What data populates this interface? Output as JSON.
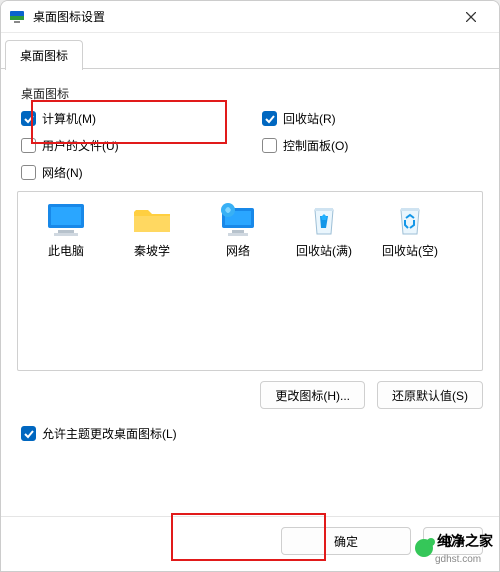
{
  "window": {
    "title": "桌面图标设置"
  },
  "tab": {
    "label": "桌面图标"
  },
  "group_label": "桌面图标",
  "checks": {
    "computer": {
      "label": "计算机(M)",
      "checked": true
    },
    "recycle": {
      "label": "回收站(R)",
      "checked": true
    },
    "userdocs": {
      "label": "用户的文件(U)",
      "checked": false
    },
    "cpanel": {
      "label": "控制面板(O)",
      "checked": false
    },
    "network": {
      "label": "网络(N)",
      "checked": false
    }
  },
  "icons": {
    "this_pc": {
      "label": "此电脑"
    },
    "qinpoxue": {
      "label": "秦坡学"
    },
    "network": {
      "label": "网络"
    },
    "recycle_full": {
      "label": "回收站(满)"
    },
    "recycle_empty": {
      "label": "回收站(空)"
    }
  },
  "buttons": {
    "change_icon": "更改图标(H)...",
    "restore_def": "还原默认值(S)",
    "ok": "确定",
    "cancel": "取消"
  },
  "allow_theme": {
    "label": "允许主题更改桌面图标(L)",
    "checked": true
  },
  "watermark": {
    "brand": "纯净之家",
    "url": "gdhst.com"
  }
}
